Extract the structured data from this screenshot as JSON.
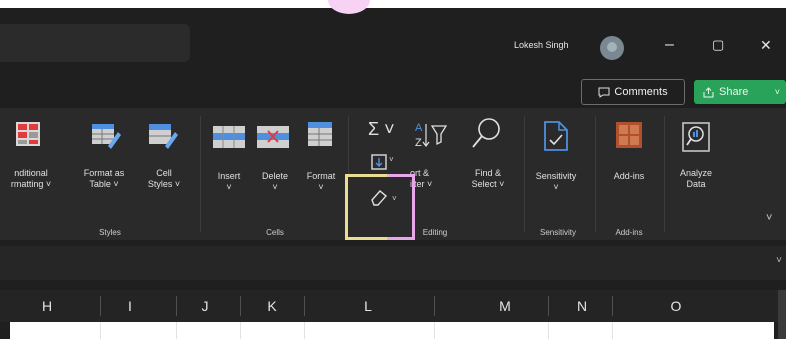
{
  "titlebar": {
    "user_name": "Lokesh Singh",
    "minimize": "–",
    "restore": "▢",
    "close": "✕"
  },
  "actions": {
    "comments_label": "Comments",
    "share_label": "Share"
  },
  "ribbon": {
    "styles": {
      "group_label": "Styles",
      "conditional_formatting": [
        "nditional",
        "rmatting ˅"
      ],
      "format_as_table": [
        "Format as",
        "Table ˅"
      ],
      "cell_styles": [
        "Cell",
        "Styles ˅"
      ]
    },
    "cells": {
      "group_label": "Cells",
      "insert": "Insert",
      "delete": "Delete",
      "format": "Format"
    },
    "editing": {
      "group_label": "Editing",
      "autosum": "Σ ˅",
      "sort_filter": [
        "ort &",
        "ilter ˅"
      ],
      "find_select": [
        "Find &",
        "Select ˅"
      ]
    },
    "sensitivity": {
      "group_label": "Sensitivity",
      "label": "Sensitivity"
    },
    "addins": {
      "group_label": "Add-ins",
      "label": "Add-ins"
    },
    "analyze": {
      "label": [
        "Analyze",
        "Data"
      ]
    }
  },
  "columns": [
    "H",
    "I",
    "J",
    "K",
    "L",
    "M",
    "N",
    "O"
  ],
  "colors": {
    "background": "#1f1f1f",
    "ribbon": "#2a2a2a",
    "share_green": "#29a35a",
    "highlight_yellow": "#e9de8e",
    "highlight_pink": "#e8a7ea"
  }
}
